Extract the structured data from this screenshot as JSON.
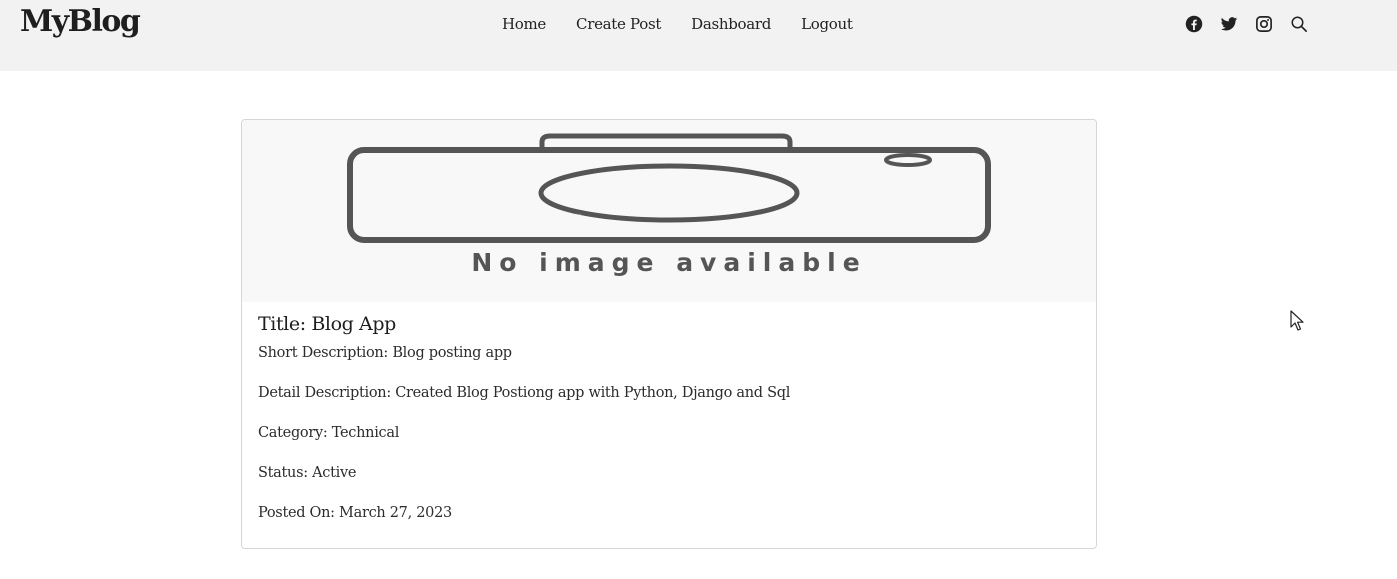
{
  "navbar": {
    "brand": "MyBlog",
    "links": [
      "Home",
      "Create Post",
      "Dashboard",
      "Logout"
    ],
    "icons": [
      "facebook-icon",
      "twitter-icon",
      "instagram-icon",
      "search-icon"
    ]
  },
  "post": {
    "image_text": "No image available",
    "title": "Title: Blog App",
    "short_description": "Short Description: Blog posting app",
    "detail_description": "Detail Description: Created Blog Postiong app with Python, Django and Sql",
    "category": "Category: Technical",
    "status": "Status: Active",
    "posted_on": "Posted On: March 27, 2023"
  },
  "colors": {
    "navbar_bg": "#f2f2f2",
    "card_border": "#d6d6d6",
    "placeholder_gray": "#555555"
  }
}
